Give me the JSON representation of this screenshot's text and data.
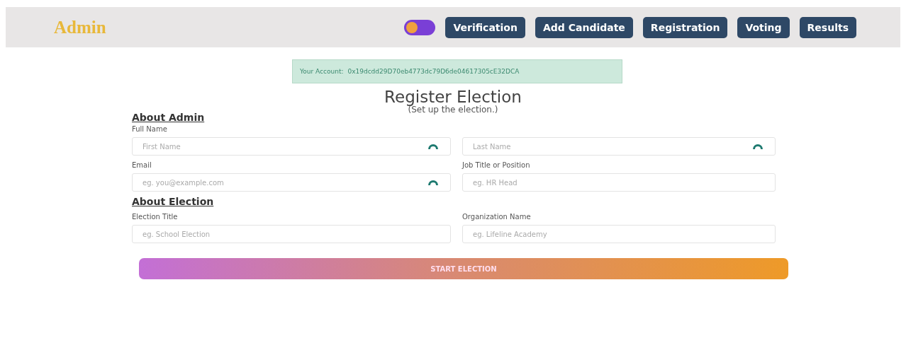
{
  "navbar": {
    "brand": "Admin",
    "theme_toggle": {
      "on": false
    },
    "links": [
      "Verification",
      "Add Candidate",
      "Registration",
      "Voting",
      "Results"
    ]
  },
  "account": {
    "label": "Your Account:",
    "address": "0x19dcdd29D70eb4773dc79D6de04617305cE32DCA"
  },
  "page": {
    "title": "Register Election",
    "subtitle": "(Set up the election.)"
  },
  "sections": [
    {
      "heading": "About Admin",
      "rows": [
        {
          "label": "Full Name",
          "fields": [
            {
              "placeholder": "First Name",
              "autofill_icon": true
            },
            {
              "placeholder": "Last Name",
              "autofill_icon": true
            }
          ]
        },
        {
          "labels": [
            "Email",
            "Job Title or Position"
          ],
          "fields": [
            {
              "placeholder": "eg. you@example.com",
              "autofill_icon": true
            },
            {
              "placeholder": "eg. HR Head",
              "autofill_icon": false
            }
          ]
        }
      ]
    },
    {
      "heading": "About Election",
      "rows": [
        {
          "labels": [
            "Election Title",
            "Organization Name"
          ],
          "fields": [
            {
              "placeholder": "eg. School Election",
              "autofill_icon": false
            },
            {
              "placeholder": "eg. Lifeline Academy",
              "autofill_icon": false
            }
          ]
        }
      ]
    }
  ],
  "submit": "START ELECTION"
}
